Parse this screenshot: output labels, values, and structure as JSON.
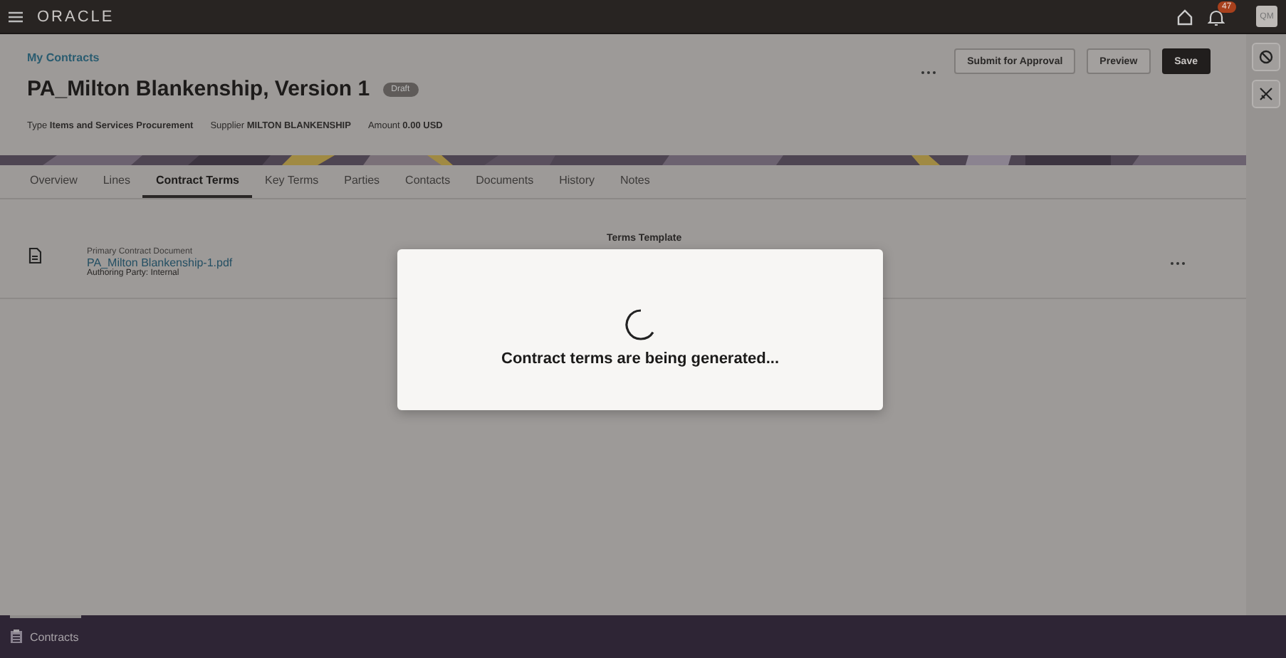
{
  "topbar": {
    "logo": "ORACLE",
    "notification_count": "47",
    "avatar": "QM"
  },
  "header": {
    "breadcrumb": "My Contracts",
    "title": "PA_Milton Blankenship, Version 1",
    "status": "Draft",
    "meta": [
      {
        "label": "Type",
        "value": "Items and Services Procurement"
      },
      {
        "label": "Supplier",
        "value": "MILTON BLANKENSHIP"
      },
      {
        "label": "Amount",
        "value": "0.00 USD"
      }
    ],
    "buttons": [
      {
        "label": "Submit for Approval",
        "kind": "secondary"
      },
      {
        "label": "Preview",
        "kind": "secondary"
      },
      {
        "label": "Save",
        "kind": "primary"
      }
    ]
  },
  "tabs": [
    {
      "label": "Overview",
      "selected": false
    },
    {
      "label": "Lines",
      "selected": false
    },
    {
      "label": "Contract Terms",
      "selected": true
    },
    {
      "label": "Key Terms",
      "selected": false
    },
    {
      "label": "Parties",
      "selected": false
    },
    {
      "label": "Contacts",
      "selected": false
    },
    {
      "label": "Documents",
      "selected": false
    },
    {
      "label": "History",
      "selected": false
    },
    {
      "label": "Notes",
      "selected": false
    }
  ],
  "document": {
    "caption": "Primary Contract Document",
    "file": "PA_Milton Blankenship-1.pdf",
    "authoring": "Authoring Party: Internal",
    "terms_template": "Terms Template"
  },
  "dialog": {
    "message": "Contract terms are being generated..."
  },
  "footer": {
    "label": "Contracts"
  }
}
